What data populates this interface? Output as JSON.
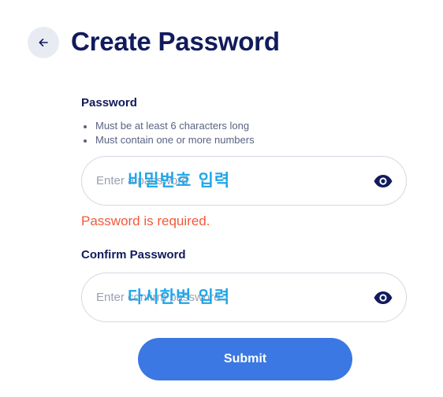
{
  "header": {
    "title": "Create Password",
    "back_icon": "arrow-left-icon"
  },
  "password": {
    "label": "Password",
    "rules": [
      "Must be at least 6 characters long",
      "Must contain one or more numbers"
    ],
    "placeholder": "Enter a password",
    "value": "",
    "overlay_text": "비밀번호 입력",
    "toggle_icon": "eye-icon",
    "error": "Password is required."
  },
  "confirm": {
    "label": "Confirm Password",
    "placeholder": "Enter confirm password",
    "value": "",
    "overlay_text": "다시한번 입력",
    "toggle_icon": "eye-icon"
  },
  "submit": {
    "label": "Submit"
  },
  "colors": {
    "title": "#111b5c",
    "error": "#f25a3a",
    "primary": "#3b78e3",
    "overlay": "#1fa6ea",
    "border": "#d4d7e2"
  }
}
